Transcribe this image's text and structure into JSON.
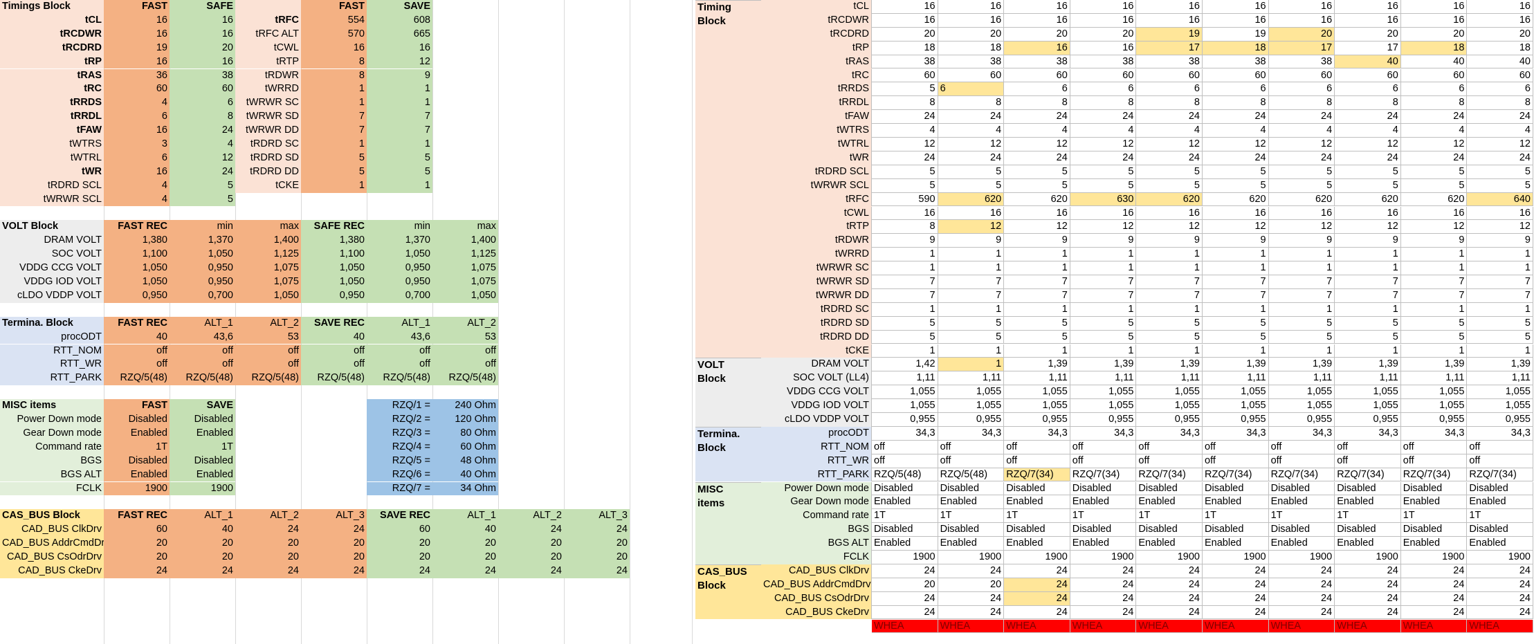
{
  "left": {
    "timings": {
      "header": [
        "Timings Block",
        "FAST",
        "SAFE",
        "",
        "FAST",
        "SAVE"
      ],
      "rows": [
        [
          "tCL",
          "16",
          "16",
          "tRFC",
          "554",
          "608",
          1,
          1
        ],
        [
          "tRCDWR",
          "16",
          "16",
          "tRFC ALT",
          "570",
          "665",
          1,
          0
        ],
        [
          "tRCDRD",
          "19",
          "20",
          "tCWL",
          "16",
          "16",
          1,
          0
        ],
        [
          "tRP",
          "16",
          "16",
          "tRTP",
          "8",
          "12",
          1,
          0
        ],
        [
          "tRAS",
          "36",
          "38",
          "tRDWR",
          "8",
          "9",
          1,
          0
        ],
        [
          "tRC",
          "60",
          "60",
          "tWRRD",
          "1",
          "1",
          1,
          0
        ],
        [
          "tRRDS",
          "4",
          "6",
          "tWRWR SC",
          "1",
          "1",
          1,
          0
        ],
        [
          "tRRDL",
          "6",
          "8",
          "tWRWR SD",
          "7",
          "7",
          1,
          0
        ],
        [
          "tFAW",
          "16",
          "24",
          "tWRWR DD",
          "7",
          "7",
          1,
          0
        ],
        [
          "tWTRS",
          "3",
          "4",
          "tRDRD SC",
          "1",
          "1",
          0,
          0
        ],
        [
          "tWTRL",
          "6",
          "12",
          "tRDRD SD",
          "5",
          "5",
          0,
          0
        ],
        [
          "tWR",
          "16",
          "24",
          "tRDRD DD",
          "5",
          "5",
          1,
          0
        ],
        [
          "tRDRD SCL",
          "4",
          "5",
          "tCKE",
          "1",
          "1",
          0,
          0
        ],
        [
          "tWRWR SCL",
          "4",
          "5",
          "",
          "",
          "",
          0,
          0
        ]
      ]
    },
    "volt": {
      "header": [
        "VOLT Block",
        "FAST REC",
        "min",
        "max",
        "SAFE REC",
        "min",
        "max"
      ],
      "rows": [
        [
          "DRAM VOLT",
          "1,380",
          "1,370",
          "1,400",
          "1,380",
          "1,370",
          "1,400"
        ],
        [
          "SOC VOLT",
          "1,100",
          "1,050",
          "1,125",
          "1,100",
          "1,050",
          "1,125"
        ],
        [
          "VDDG CCG VOLT",
          "1,050",
          "0,950",
          "1,075",
          "1,050",
          "0,950",
          "1,075"
        ],
        [
          "VDDG IOD VOLT",
          "1,050",
          "0,950",
          "1,075",
          "1,050",
          "0,950",
          "1,075"
        ],
        [
          "cLDO VDDP VOLT",
          "0,950",
          "0,700",
          "1,050",
          "0,950",
          "0,700",
          "1,050"
        ]
      ]
    },
    "termina": {
      "header": [
        "Termina. Block",
        "FAST REC",
        "ALT_1",
        "ALT_2",
        "SAVE REC",
        "ALT_1",
        "ALT_2"
      ],
      "rows": [
        [
          "procODT",
          "40",
          "43,6",
          "53",
          "40",
          "43,6",
          "53"
        ],
        [
          "RTT_NOM",
          "off",
          "off",
          "off",
          "off",
          "off",
          "off"
        ],
        [
          "RTT_WR",
          "off",
          "off",
          "off",
          "off",
          "off",
          "off"
        ],
        [
          "RTT_PARK",
          "RZQ/5(48)",
          "RZQ/5(48)",
          "RZQ/5(48)",
          "RZQ/5(48)",
          "RZQ/5(48)",
          "RZQ/5(48)"
        ]
      ]
    },
    "misc": {
      "header": [
        "MISC items",
        "FAST",
        "SAVE"
      ],
      "rows": [
        [
          "Power Down mode",
          "Disabled",
          "Disabled"
        ],
        [
          "Gear Down mode",
          "Enabled",
          "Enabled"
        ],
        [
          "Command rate",
          "1T",
          "1T"
        ],
        [
          "BGS",
          "Disabled",
          "Disabled"
        ],
        [
          "BGS ALT",
          "Enabled",
          "Enabled"
        ],
        [
          "FCLK",
          "1900",
          "1900"
        ]
      ]
    },
    "rzq": [
      [
        "RZQ/1 =",
        "240 Ohm"
      ],
      [
        "RZQ/2 =",
        "120 Ohm"
      ],
      [
        "RZQ/3 =",
        "80 Ohm"
      ],
      [
        "RZQ/4 =",
        "60 Ohm"
      ],
      [
        "RZQ/5 =",
        "48 Ohm"
      ],
      [
        "RZQ/6 =",
        "40 Ohm"
      ],
      [
        "RZQ/7 =",
        "34 Ohm"
      ]
    ],
    "casbus": {
      "header": [
        "CAS_BUS Block",
        "FAST REC",
        "ALT_1",
        "ALT_2",
        "ALT_3",
        "SAVE REC",
        "ALT_1",
        "ALT_2",
        "ALT_3"
      ],
      "rows": [
        [
          "CAD_BUS ClkDrv",
          "60",
          "40",
          "24",
          "24",
          "60",
          "40",
          "24",
          "24"
        ],
        [
          "CAD_BUS AddrCmdDrv",
          "20",
          "20",
          "20",
          "20",
          "20",
          "20",
          "20",
          "20"
        ],
        [
          "CAD_BUS CsOdrDrv",
          "20",
          "20",
          "20",
          "20",
          "20",
          "20",
          "20",
          "20"
        ],
        [
          "CAD_BUS CkeDrv",
          "24",
          "24",
          "24",
          "24",
          "24",
          "24",
          "24",
          "24"
        ]
      ]
    }
  },
  "right": {
    "block_titles": {
      "timing": "Timing\nBlock",
      "volt": "VOLT\nBlock",
      "termina": "Termina.\nBlock",
      "misc": "MISC\nitems",
      "casbus": "CAS_BUS\nBlock"
    },
    "rows": [
      {
        "label": "tCL",
        "v": [
          "16",
          "16",
          "16",
          "16",
          "16",
          "16",
          "16",
          "16",
          "16",
          "16"
        ]
      },
      {
        "label": "tRCDWR",
        "v": [
          "16",
          "16",
          "16",
          "16",
          "16",
          "16",
          "16",
          "16",
          "16",
          "16"
        ]
      },
      {
        "label": "tRCDRD",
        "v": [
          "20",
          "20",
          "20",
          "20",
          "19",
          "19",
          "20",
          "20",
          "20",
          "20"
        ],
        "hl": [
          4,
          6
        ]
      },
      {
        "label": "tRP",
        "v": [
          "18",
          "18",
          "16",
          "16",
          "17",
          "18",
          "17",
          "17",
          "18",
          "18"
        ],
        "hl": [
          2,
          4,
          5,
          6,
          8
        ]
      },
      {
        "label": "tRAS",
        "v": [
          "38",
          "38",
          "38",
          "38",
          "38",
          "38",
          "38",
          "40",
          "40",
          "40"
        ],
        "hl": [
          7
        ]
      },
      {
        "label": "tRC",
        "v": [
          "60",
          "60",
          "60",
          "60",
          "60",
          "60",
          "60",
          "60",
          "60",
          "60"
        ]
      },
      {
        "label": "tRRDS",
        "v": [
          "5",
          "6",
          "6",
          "6",
          "6",
          "6",
          "6",
          "6",
          "6",
          "6"
        ],
        "hl": [
          1
        ],
        "left1": true
      },
      {
        "label": "tRRDL",
        "v": [
          "8",
          "8",
          "8",
          "8",
          "8",
          "8",
          "8",
          "8",
          "8",
          "8"
        ]
      },
      {
        "label": "tFAW",
        "v": [
          "24",
          "24",
          "24",
          "24",
          "24",
          "24",
          "24",
          "24",
          "24",
          "24"
        ]
      },
      {
        "label": "tWTRS",
        "v": [
          "4",
          "4",
          "4",
          "4",
          "4",
          "4",
          "4",
          "4",
          "4",
          "4"
        ]
      },
      {
        "label": "tWTRL",
        "v": [
          "12",
          "12",
          "12",
          "12",
          "12",
          "12",
          "12",
          "12",
          "12",
          "12"
        ]
      },
      {
        "label": "tWR",
        "v": [
          "24",
          "24",
          "24",
          "24",
          "24",
          "24",
          "24",
          "24",
          "24",
          "24"
        ]
      },
      {
        "label": "tRDRD SCL",
        "v": [
          "5",
          "5",
          "5",
          "5",
          "5",
          "5",
          "5",
          "5",
          "5",
          "5"
        ]
      },
      {
        "label": "tWRWR SCL",
        "v": [
          "5",
          "5",
          "5",
          "5",
          "5",
          "5",
          "5",
          "5",
          "5",
          "5"
        ]
      },
      {
        "label": "tRFC",
        "v": [
          "590",
          "620",
          "620",
          "630",
          "620",
          "620",
          "620",
          "620",
          "620",
          "640"
        ],
        "hl": [
          1,
          3,
          4,
          9
        ]
      },
      {
        "label": "tCWL",
        "v": [
          "16",
          "16",
          "16",
          "16",
          "16",
          "16",
          "16",
          "16",
          "16",
          "16"
        ]
      },
      {
        "label": "tRTP",
        "v": [
          "8",
          "12",
          "12",
          "12",
          "12",
          "12",
          "12",
          "12",
          "12",
          "12"
        ],
        "hl": [
          1
        ]
      },
      {
        "label": "tRDWR",
        "v": [
          "9",
          "9",
          "9",
          "9",
          "9",
          "9",
          "9",
          "9",
          "9",
          "9"
        ]
      },
      {
        "label": "tWRRD",
        "v": [
          "1",
          "1",
          "1",
          "1",
          "1",
          "1",
          "1",
          "1",
          "1",
          "1"
        ]
      },
      {
        "label": "tWRWR SC",
        "v": [
          "1",
          "1",
          "1",
          "1",
          "1",
          "1",
          "1",
          "1",
          "1",
          "1"
        ]
      },
      {
        "label": "tWRWR SD",
        "v": [
          "7",
          "7",
          "7",
          "7",
          "7",
          "7",
          "7",
          "7",
          "7",
          "7"
        ]
      },
      {
        "label": "tWRWR DD",
        "v": [
          "7",
          "7",
          "7",
          "7",
          "7",
          "7",
          "7",
          "7",
          "7",
          "7"
        ]
      },
      {
        "label": "tRDRD SC",
        "v": [
          "1",
          "1",
          "1",
          "1",
          "1",
          "1",
          "1",
          "1",
          "1",
          "1"
        ]
      },
      {
        "label": "tRDRD SD",
        "v": [
          "5",
          "5",
          "5",
          "5",
          "5",
          "5",
          "5",
          "5",
          "5",
          "5"
        ]
      },
      {
        "label": "tRDRD DD",
        "v": [
          "5",
          "5",
          "5",
          "5",
          "5",
          "5",
          "5",
          "5",
          "5",
          "5"
        ]
      },
      {
        "label": "tCKE",
        "v": [
          "1",
          "1",
          "1",
          "1",
          "1",
          "1",
          "1",
          "1",
          "1",
          "1"
        ]
      },
      {
        "label": "DRAM VOLT",
        "v": [
          "1,42",
          "1",
          "1,39",
          "1,39",
          "1,39",
          "1,39",
          "1,39",
          "1,39",
          "1,39",
          "1,39"
        ],
        "hl": [
          1
        ]
      },
      {
        "label": "SOC VOLT (LL4)",
        "v": [
          "1,11",
          "1,11",
          "1,11",
          "1,11",
          "1,11",
          "1,11",
          "1,11",
          "1,11",
          "1,11",
          "1,11"
        ]
      },
      {
        "label": "VDDG CCG VOLT",
        "v": [
          "1,055",
          "1,055",
          "1,055",
          "1,055",
          "1,055",
          "1,055",
          "1,055",
          "1,055",
          "1,055",
          "1,055"
        ]
      },
      {
        "label": "VDDG IOD VOLT",
        "v": [
          "1,055",
          "1,055",
          "1,055",
          "1,055",
          "1,055",
          "1,055",
          "1,055",
          "1,055",
          "1,055",
          "1,055"
        ]
      },
      {
        "label": "cLDO VDDP VOLT",
        "v": [
          "0,955",
          "0,955",
          "0,955",
          "0,955",
          "0,955",
          "0,955",
          "0,955",
          "0,955",
          "0,955",
          "0,955"
        ]
      },
      {
        "label": "procODT",
        "v": [
          "34,3",
          "34,3",
          "34,3",
          "34,3",
          "34,3",
          "34,3",
          "34,3",
          "34,3",
          "34,3",
          "34,3"
        ]
      },
      {
        "label": "RTT_NOM",
        "v": [
          "off",
          "off",
          "off",
          "off",
          "off",
          "off",
          "off",
          "off",
          "off",
          "off"
        ],
        "align": "l"
      },
      {
        "label": "RTT_WR",
        "v": [
          "off",
          "off",
          "off",
          "off",
          "off",
          "off",
          "off",
          "off",
          "off",
          "off"
        ],
        "align": "l"
      },
      {
        "label": "RTT_PARK",
        "v": [
          "RZQ/5(48)",
          "RZQ/5(48)",
          "RZQ/7(34)",
          "RZQ/7(34)",
          "RZQ/7(34)",
          "RZQ/7(34)",
          "RZQ/7(34)",
          "RZQ/7(34)",
          "RZQ/7(34)",
          "RZQ/7(34)"
        ],
        "hl": [
          2
        ],
        "align": "l"
      },
      {
        "label": "Power Down mode",
        "v": [
          "Disabled",
          "Disabled",
          "Disabled",
          "Disabled",
          "Disabled",
          "Disabled",
          "Disabled",
          "Disabled",
          "Disabled",
          "Disabled"
        ],
        "align": "l"
      },
      {
        "label": "Gear Down mode",
        "v": [
          "Enabled",
          "Enabled",
          "Enabled",
          "Enabled",
          "Enabled",
          "Enabled",
          "Enabled",
          "Enabled",
          "Enabled",
          "Enabled"
        ],
        "align": "l"
      },
      {
        "label": "Command rate",
        "v": [
          "1T",
          "1T",
          "1T",
          "1T",
          "1T",
          "1T",
          "1T",
          "1T",
          "1T",
          "1T"
        ],
        "align": "l"
      },
      {
        "label": "BGS",
        "v": [
          "Disabled",
          "Disabled",
          "Disabled",
          "Disabled",
          "Disabled",
          "Disabled",
          "Disabled",
          "Disabled",
          "Disabled",
          "Disabled"
        ],
        "align": "l"
      },
      {
        "label": "BGS ALT",
        "v": [
          "Enabled",
          "Enabled",
          "Enabled",
          "Enabled",
          "Enabled",
          "Enabled",
          "Enabled",
          "Enabled",
          "Enabled",
          "Enabled"
        ],
        "align": "l"
      },
      {
        "label": "FCLK",
        "v": [
          "1900",
          "1900",
          "1900",
          "1900",
          "1900",
          "1900",
          "1900",
          "1900",
          "1900",
          "1900"
        ]
      },
      {
        "label": "CAD_BUS ClkDrv",
        "v": [
          "24",
          "24",
          "24",
          "24",
          "24",
          "24",
          "24",
          "24",
          "24",
          "24"
        ]
      },
      {
        "label": "CAD_BUS AddrCmdDrv",
        "v": [
          "20",
          "20",
          "24",
          "24",
          "24",
          "24",
          "24",
          "24",
          "24",
          "24"
        ],
        "hl": [
          2
        ]
      },
      {
        "label": "CAD_BUS CsOdrDrv",
        "v": [
          "24",
          "24",
          "24",
          "24",
          "24",
          "24",
          "24",
          "24",
          "24",
          "24"
        ],
        "hl": [
          2
        ]
      },
      {
        "label": "CAD_BUS CkeDrv",
        "v": [
          "24",
          "24",
          "24",
          "24",
          "24",
          "24",
          "24",
          "24",
          "24",
          "24"
        ]
      },
      {
        "label": "",
        "v": [
          "WHEA",
          "WHEA",
          "WHEA",
          "WHEA",
          "WHEA",
          "WHEA",
          "WHEA",
          "WHEA",
          "WHEA",
          "WHEA"
        ],
        "whea": true
      }
    ]
  }
}
